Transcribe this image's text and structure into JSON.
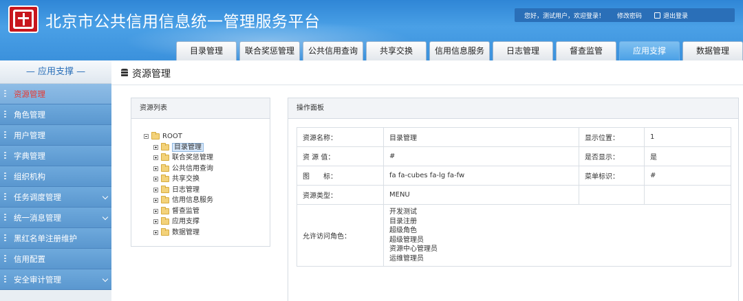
{
  "header": {
    "site_title": "北京市公共信用信息统一管理服务平台",
    "welcome": "您好，测试用户，欢迎登录！",
    "change_password": "修改密码",
    "logout": "退出登录",
    "colors": {
      "header_blue": "#3b91dc",
      "active_red": "#e8382f"
    }
  },
  "nav": {
    "tabs": [
      "目录管理",
      "联合奖惩管理",
      "公共信用查询",
      "共享交换",
      "信用信息服务",
      "日志管理",
      "督查监管",
      "应用支撑",
      "数据管理"
    ],
    "active": "应用支撑"
  },
  "sidebar": {
    "title": "— 应用支撑 —",
    "items": [
      {
        "label": "资源管理",
        "active": true,
        "has_children": false
      },
      {
        "label": "角色管理",
        "active": false,
        "has_children": false
      },
      {
        "label": "用户管理",
        "active": false,
        "has_children": false
      },
      {
        "label": "字典管理",
        "active": false,
        "has_children": false
      },
      {
        "label": "组织机构",
        "active": false,
        "has_children": false
      },
      {
        "label": "任务调度管理",
        "active": false,
        "has_children": true
      },
      {
        "label": "统一消息管理",
        "active": false,
        "has_children": true
      },
      {
        "label": "黑红名单注册维护",
        "active": false,
        "has_children": false
      },
      {
        "label": "信用配置",
        "active": false,
        "has_children": false
      },
      {
        "label": "安全审计管理",
        "active": false,
        "has_children": true
      }
    ]
  },
  "main": {
    "page_title": "资源管理",
    "resource_list": {
      "title": "资源列表",
      "root": "ROOT",
      "children": [
        "目录管理",
        "联合奖惩管理",
        "公共信用查询",
        "共享交换",
        "日志管理",
        "信用信息服务",
        "督查监管",
        "应用支撑",
        "数据管理"
      ],
      "selected": "目录管理"
    },
    "operation_panel": {
      "title": "操作面板",
      "resource_name_label": "资源名称：",
      "resource_name": "目录管理",
      "display_position_label": "显示位置：",
      "display_position": "1",
      "resource_value_label": "资 源 值：",
      "resource_value": "#",
      "is_displayed_label": "是否显示：",
      "is_displayed": "是",
      "icon_label": "图　　标：",
      "icon_value": "fa fa-cubes fa-lg fa-fw",
      "menu_flag_label": "菜单标识：",
      "menu_flag": "#",
      "resource_type_label": "资源类型：",
      "resource_type": "MENU",
      "roles_label": "允许访问角色：",
      "roles": [
        "开发测试",
        "目录注册",
        "超级角色",
        "超级管理员",
        "资源中心管理员",
        "运维管理员"
      ]
    }
  }
}
